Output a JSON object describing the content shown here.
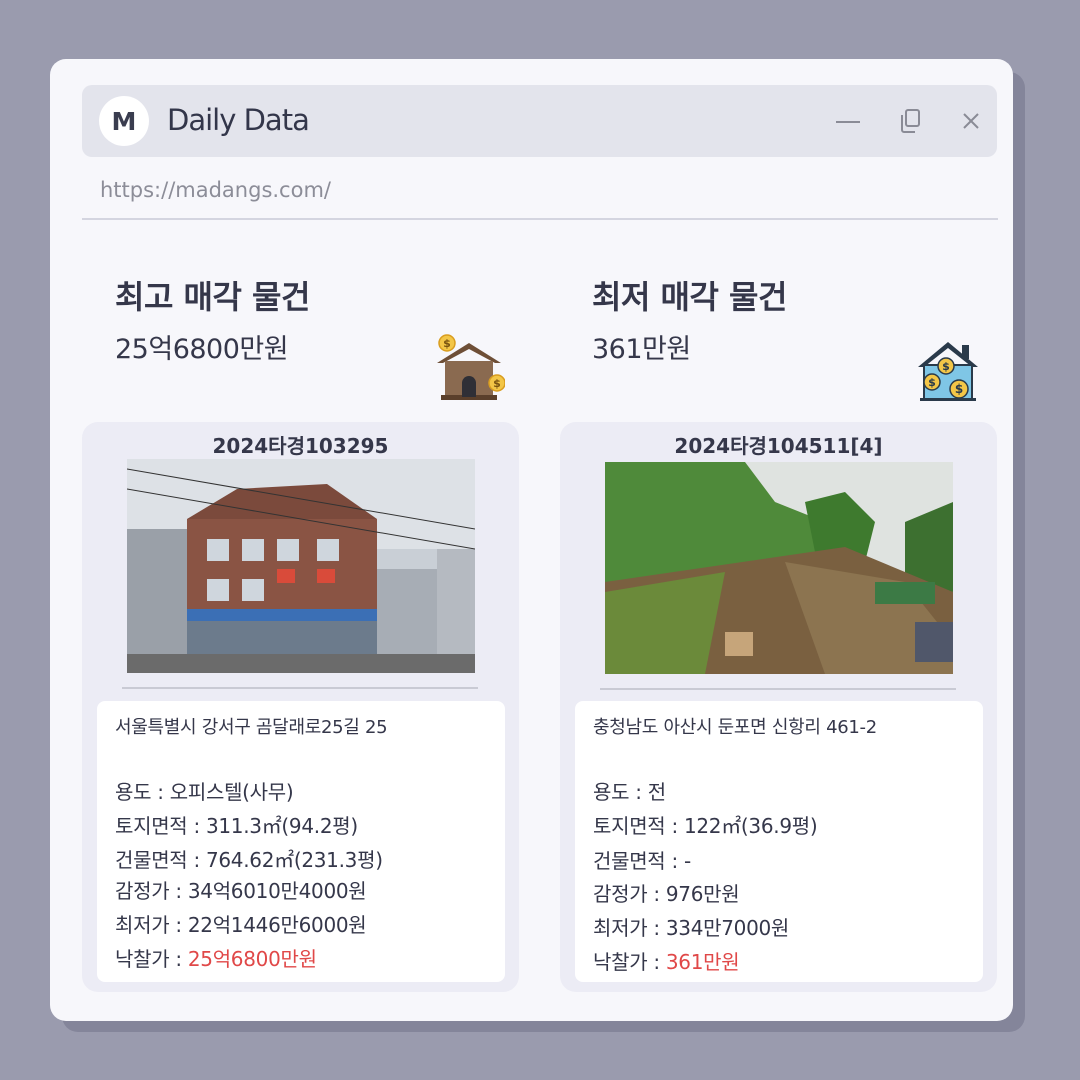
{
  "window": {
    "avatar_letter": "M",
    "title": "Daily Data",
    "url": "https://madangs.com/"
  },
  "icons": {
    "minimize": "minimize-icon",
    "restore": "restore-icon",
    "close": "close-icon",
    "house_coins": "house-dollar-icon",
    "house_money": "house-money-icon"
  },
  "colors": {
    "accent_red": "#e04848",
    "text": "#35374a",
    "background": "#9a9bae"
  },
  "highest": {
    "heading": "최고 매각 물건",
    "price": "25억6800만원",
    "case_no": "2024타경103295",
    "address": "서울특별시 강서구 곰달래로25길 25",
    "usage_label": "용도 : ",
    "usage": "오피스텔(사무)",
    "land_label": "토지면적 : ",
    "land": "311.3㎡(94.2평)",
    "building_label": "건물면적 : ",
    "building": "764.62㎡(231.3평)",
    "appraisal_label": "감정가 : ",
    "appraisal": "34억6010만4000원",
    "min_label": "최저가 : ",
    "min": "22억1446만6000원",
    "winning_label": "낙찰가 : ",
    "winning": "25억6800만원"
  },
  "lowest": {
    "heading": "최저 매각 물건",
    "price": "361만원",
    "case_no": "2024타경104511[4]",
    "address": "충청남도 아산시 둔포면 신항리 461-2",
    "usage_label": "용도 : ",
    "usage": "전",
    "land_label": "토지면적 : ",
    "land": "122㎡(36.9평)",
    "building_label": "건물면적 : ",
    "building": "-",
    "appraisal_label": "감정가 : ",
    "appraisal": "976만원",
    "min_label": "최저가 : ",
    "min": "334만7000원",
    "winning_label": "낙찰가 : ",
    "winning": "361만원"
  }
}
